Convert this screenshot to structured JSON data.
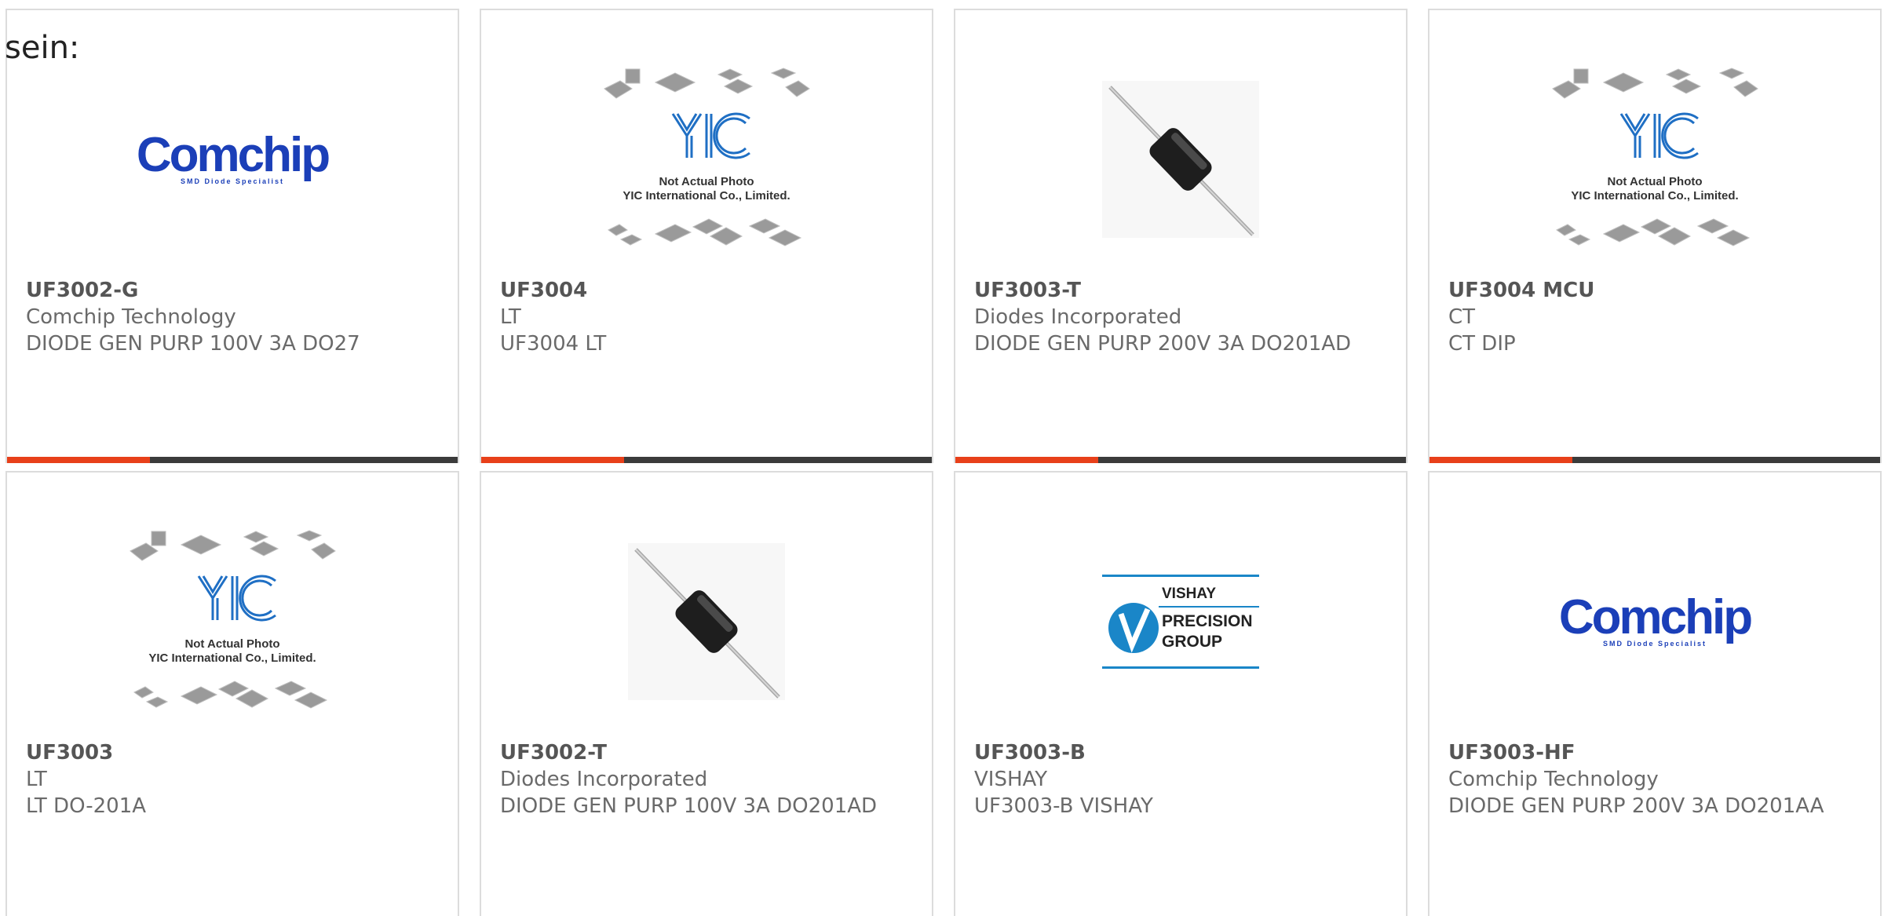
{
  "intro_text": "sein:",
  "colors": {
    "accent": "#e8401a",
    "bar": "#3b3b3b",
    "comchip_blue": "#1b3fb8",
    "yic_blue": "#1f6fc4",
    "vishay_blue": "#1a86c8"
  },
  "logos": {
    "comchip_word": "Comchip",
    "comchip_tagline": "SMD Diode Specialist",
    "yic_note_line1": "Not Actual Photo",
    "yic_note_line2": "YIC International Co., Limited.",
    "vishay_line1": "VISHAY",
    "vishay_line2": "PRECISION",
    "vishay_line3": "GROUP"
  },
  "products": [
    {
      "part": "UF3002-G",
      "maker": "Comchip Technology",
      "desc": "DIODE GEN PURP 100V 3A DO27",
      "image": "comchip-logo"
    },
    {
      "part": "UF3004",
      "maker": "LT",
      "desc": "UF3004 LT",
      "image": "yic-placeholder"
    },
    {
      "part": "UF3003-T",
      "maker": "Diodes Incorporated",
      "desc": "DIODE GEN PURP 200V 3A DO201AD",
      "image": "diode-photo"
    },
    {
      "part": "UF3004 MCU",
      "maker": "CT",
      "desc": "CT DIP",
      "image": "yic-placeholder"
    },
    {
      "part": "UF3003",
      "maker": "LT",
      "desc": "LT DO-201A",
      "image": "yic-placeholder"
    },
    {
      "part": "UF3002-T",
      "maker": "Diodes Incorporated",
      "desc": "DIODE GEN PURP 100V 3A DO201AD",
      "image": "diode-photo"
    },
    {
      "part": "UF3003-B",
      "maker": "VISHAY",
      "desc": "UF3003-B VISHAY",
      "image": "vishay-logo"
    },
    {
      "part": "UF3003-HF",
      "maker": "Comchip Technology",
      "desc": "DIODE GEN PURP 200V 3A DO201AA",
      "image": "comchip-logo"
    }
  ]
}
